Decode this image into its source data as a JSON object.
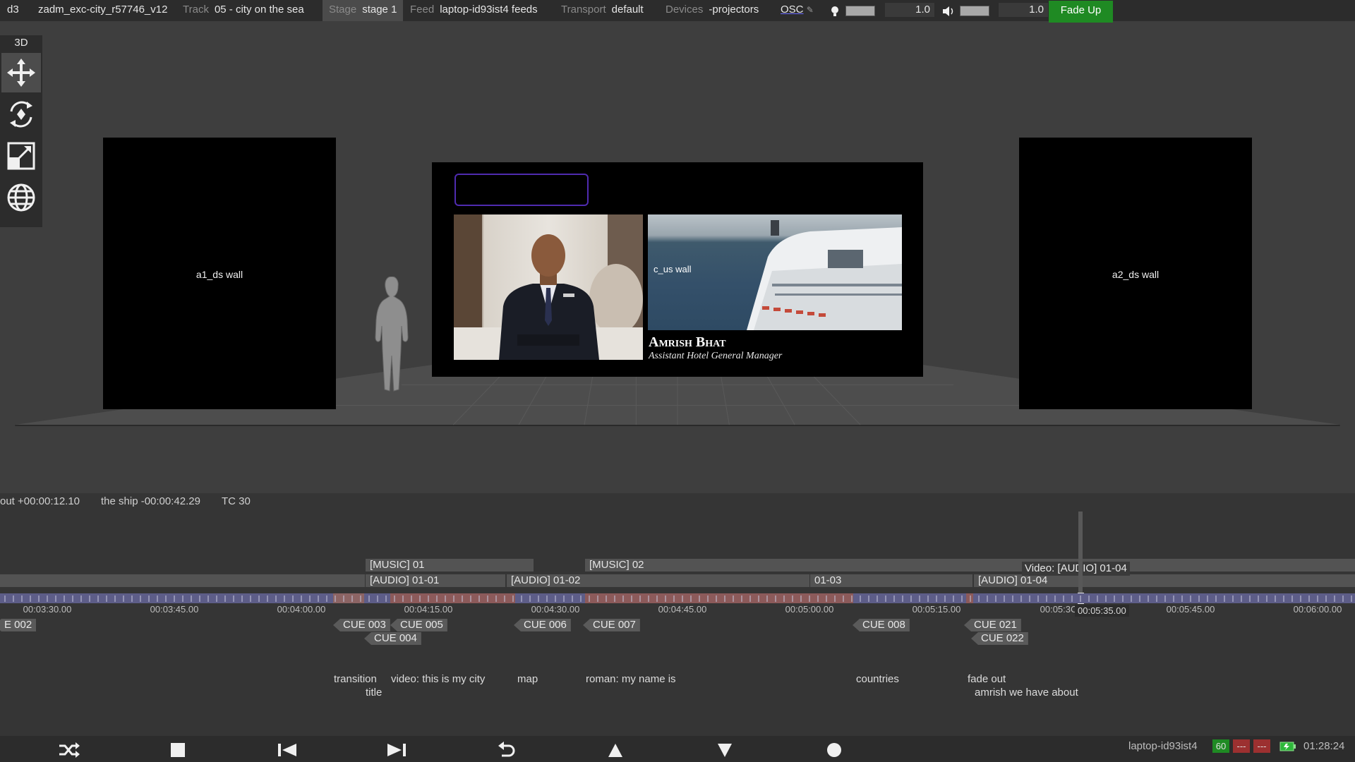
{
  "topbar": {
    "app": "d3",
    "project": "zadm_exc-city_r57746_v12",
    "track_label": "Track",
    "track_value": "05 - city on the sea",
    "stage_label": "Stage",
    "stage_value": "stage 1",
    "feed_label": "Feed",
    "feed_value": "laptop-id93ist4 feeds",
    "transport_label": "Transport",
    "transport_value": "default",
    "devices_label": "Devices",
    "devices_value": "-projectors",
    "osc_label": "OSC",
    "brightness_value": "1.0",
    "volume_value": "1.0",
    "fade_button": "Fade Up"
  },
  "tools": {
    "mode": "3D",
    "items": [
      "move-icon",
      "rotate-icon",
      "scale-icon",
      "globe-icon"
    ]
  },
  "viewport": {
    "left_screen": "a1_ds wall",
    "right_screen": "a2_ds wall",
    "center_screen": "c_us wall",
    "lower_third_name": "Amrish Bhat",
    "lower_third_title": "Assistant Hotel General Manager"
  },
  "timeline": {
    "header": [
      "out +00:00:12.10",
      "the ship -00:00:42.29",
      "TC 30"
    ],
    "music_bars": [
      "[MUSIC] 01",
      "[MUSIC] 02"
    ],
    "audio_bars": [
      "[AUDIO] 01-01",
      "[AUDIO] 01-02",
      "01-03",
      "[AUDIO] 01-04"
    ],
    "tooltip": "Video: [AUDIO] 01-04",
    "time_labels": [
      "00:03:30.00",
      "00:03:45.00",
      "00:04:00.00",
      "00:04:15.00",
      "00:04:30.00",
      "00:04:45.00",
      "00:05:00.00",
      "00:05:15.00",
      "00:05:3C",
      "00:05:45.00",
      "00:06:00.00"
    ],
    "playhead_time": "00:05:35.00",
    "cues": [
      "E 002",
      "CUE 003",
      "CUE 005",
      "CUE 004",
      "CUE 006",
      "CUE 007",
      "CUE 008",
      "CUE 021",
      "CUE 022"
    ],
    "notes": [
      "transition",
      "title",
      "video: this is my city",
      "map",
      "roman: my name is",
      "countries",
      "fade out",
      "amrish we have about"
    ]
  },
  "status": {
    "machine": "laptop-id93ist4",
    "fps": "60",
    "ind1": "---",
    "ind2": "---",
    "clock": "01:28:24"
  },
  "colors": {
    "accent_green": "#1f8a23",
    "timeline_blue": "#5d5d88",
    "timeline_red": "#8c5a5a"
  }
}
